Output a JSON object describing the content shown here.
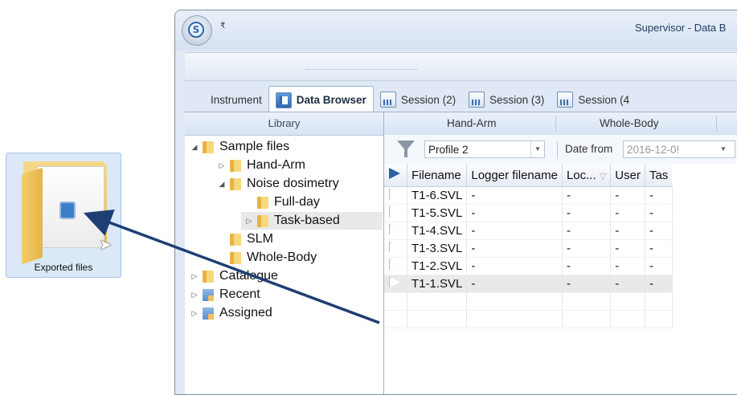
{
  "desktop": {
    "folder_caption": "Exported files"
  },
  "window": {
    "title": "Supervisor - Data B",
    "qat_glyph": "₹"
  },
  "tabs": [
    {
      "label": "Instrument",
      "icon": "instrument-icon"
    },
    {
      "label": "Data Browser",
      "icon": "data-browser-icon",
      "active": true
    },
    {
      "label": "Session (2)",
      "icon": "session-icon"
    },
    {
      "label": "Session (3)",
      "icon": "session-icon"
    },
    {
      "label": "Session (4",
      "icon": "session-icon"
    }
  ],
  "library": {
    "header": "Library",
    "tree": [
      {
        "label": "Sample files",
        "expander": "◢",
        "icon": "folder-icon"
      },
      {
        "label": "Hand-Arm",
        "expander": "▷",
        "icon": "folder-icon"
      },
      {
        "label": "Noise dosimetry",
        "expander": "◢",
        "icon": "folder-icon"
      },
      {
        "label": "Full-day",
        "expander": "",
        "icon": "folder-icon"
      },
      {
        "label": "Task-based",
        "expander": "▷",
        "icon": "folder-icon",
        "selected": true
      },
      {
        "label": "SLM",
        "expander": "",
        "icon": "folder-icon"
      },
      {
        "label": "Whole-Body",
        "expander": "",
        "icon": "folder-icon"
      },
      {
        "label": "Catalogue",
        "expander": "▷",
        "icon": "folder-icon"
      },
      {
        "label": "Recent",
        "expander": "▷",
        "icon": "recent-icon"
      },
      {
        "label": "Assigned",
        "expander": "▷",
        "icon": "assigned-icon"
      }
    ]
  },
  "browser": {
    "groups": [
      "Hand-Arm",
      "Whole-Body"
    ],
    "profile": "Profile 2",
    "date_from_label": "Date from",
    "date_from_value": "2016-12-0!",
    "columns": [
      "Filename",
      "Logger filename",
      "Loc...",
      "User",
      "Tas"
    ],
    "rows": [
      {
        "filename": "T1-6.SVL",
        "logger": "-",
        "loc": "-",
        "user": "-",
        "task": "-"
      },
      {
        "filename": "T1-5.SVL",
        "logger": "-",
        "loc": "-",
        "user": "-",
        "task": "-"
      },
      {
        "filename": "T1-4.SVL",
        "logger": "-",
        "loc": "-",
        "user": "-",
        "task": "-"
      },
      {
        "filename": "T1-3.SVL",
        "logger": "-",
        "loc": "-",
        "user": "-",
        "task": "-"
      },
      {
        "filename": "T1-2.SVL",
        "logger": "-",
        "loc": "-",
        "user": "-",
        "task": "-"
      },
      {
        "filename": "T1-1.SVL",
        "logger": "-",
        "loc": "-",
        "user": "-",
        "task": "-",
        "selected": true
      }
    ]
  },
  "colors": {
    "arrow": "#1f3e73",
    "accent": "#2f67b6"
  }
}
